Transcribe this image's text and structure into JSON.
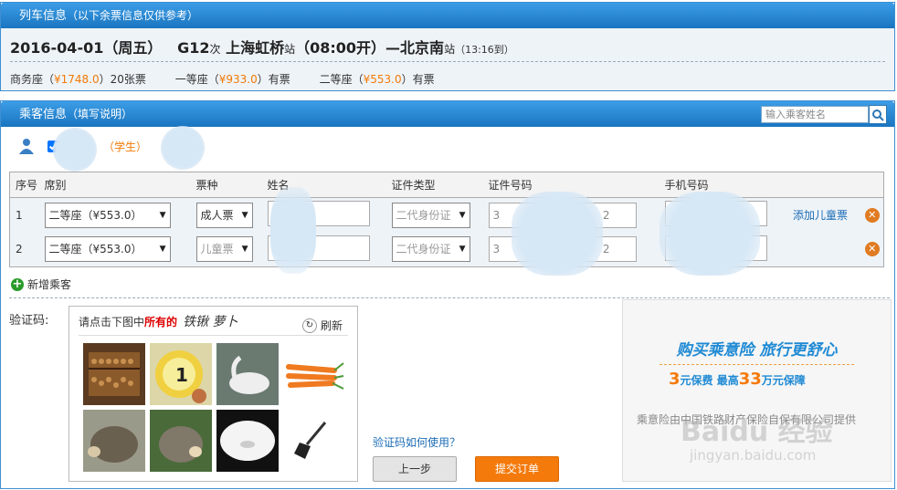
{
  "train": {
    "title": "列车信息",
    "title_note": "（以下余票信息仅供参考）",
    "date": "2016-04-01（周五）",
    "number": "G12",
    "number_suffix": "次",
    "from": "上海虹桥",
    "from_suffix": "站",
    "depart": "（08:00开）",
    "arrow": "—",
    "to": "北京南",
    "to_suffix": "站",
    "arrive": "（13:16到）",
    "seats": [
      {
        "name": "商务座（",
        "price": "¥1748.0",
        "tail": "）20张票"
      },
      {
        "name": "一等座（",
        "price": "¥933.0",
        "tail": "）有票"
      },
      {
        "name": "二等座（",
        "price": "¥553.0",
        "tail": "）有票"
      }
    ]
  },
  "passenger": {
    "title": "乘客信息",
    "title_note": "（填写说明）",
    "search_placeholder": "输入乘客姓名",
    "student_label": "（学生）",
    "columns": [
      "序号",
      "席别",
      "票种",
      "姓名",
      "证件类型",
      "证件号码",
      "手机号码"
    ],
    "rows": [
      {
        "no": "1",
        "seat": "二等座（¥553.0）",
        "ticket": "成人票",
        "id_type": "二代身份证",
        "id_start": "3",
        "id_end": "2",
        "action": "添加儿童票"
      },
      {
        "no": "2",
        "seat": "二等座（¥553.0）",
        "ticket": "儿童票",
        "id_type": "二代身份证",
        "id_start": "3",
        "id_end": "2",
        "action": ""
      }
    ],
    "add_label": "新增乘客"
  },
  "captcha": {
    "label": "验证码:",
    "prompt": "请点击下图中",
    "prompt_red": "所有的",
    "target": "铁锹  萝卜",
    "refresh": "刷新",
    "help": "验证码如何使用？"
  },
  "buttons": {
    "prev": "上一步",
    "submit": "提交订单"
  },
  "insurance": {
    "title": "购买乘意险  旅行更舒心",
    "price_num": "3",
    "price_text": "元保费  最高",
    "cover_num": "33",
    "cover_text": "万元保障",
    "note": "乘意险由中国铁路财产保险自保有限公司提供"
  },
  "watermark": {
    "brand": "Baidu 经验",
    "url": "jingyan.baidu.com"
  },
  "colors": {
    "header_blue": "#1a75c0",
    "price_orange": "#f27a06",
    "submit_orange": "#f57a0c",
    "link_blue": "#1c6cb5"
  }
}
